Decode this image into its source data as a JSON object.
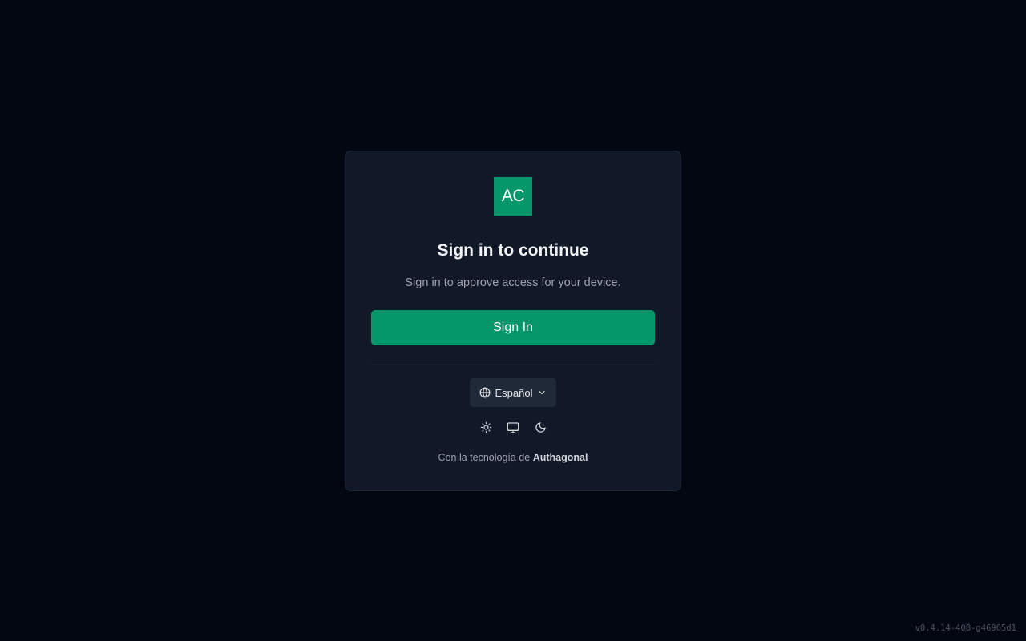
{
  "logo": {
    "text": "AC",
    "color": "#059669"
  },
  "heading": "Sign in to continue",
  "subheading": "Sign in to approve access for your device.",
  "signin_button": {
    "label": "Sign In",
    "color": "#059669"
  },
  "language": {
    "selected": "Español",
    "icon": "globe-icon",
    "chevron": "chevron-down-icon"
  },
  "theme_toggle": [
    {
      "name": "light",
      "icon": "sun-icon"
    },
    {
      "name": "system",
      "icon": "monitor-icon"
    },
    {
      "name": "dark",
      "icon": "moon-icon"
    }
  ],
  "footer": {
    "prefix": "Con la tecnología de",
    "brand": "Authagonal"
  },
  "version": "v0.4.14-408-g46965d1",
  "colors": {
    "background": "#030712",
    "card": "#111827",
    "accent": "#059669"
  }
}
